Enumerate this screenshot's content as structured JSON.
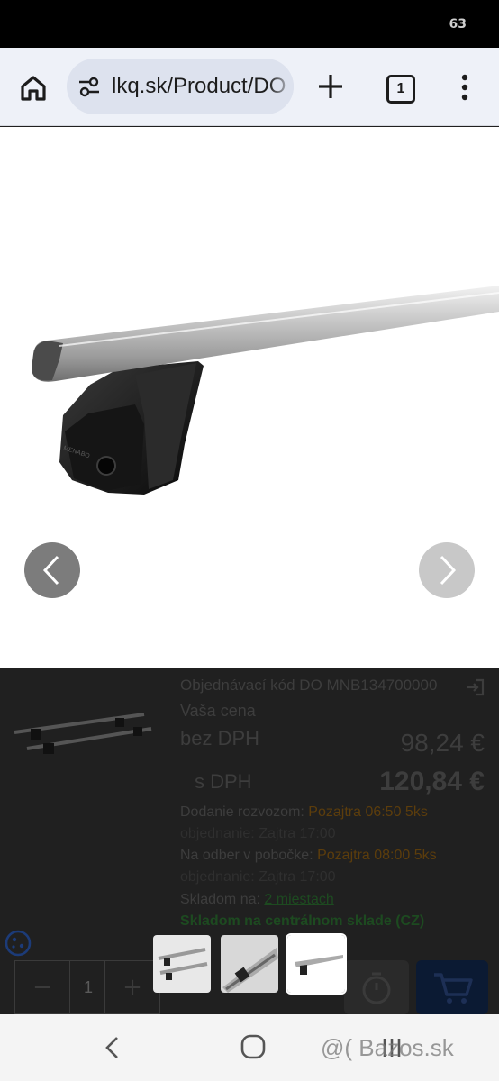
{
  "status_bar": {
    "battery": "63"
  },
  "browser": {
    "url": "lkq.sk/Product/DO",
    "tab_count": "1",
    "icons": [
      "home-icon",
      "site-settings-icon",
      "new-tab-icon",
      "tabs-icon",
      "menu-icon"
    ]
  },
  "viewer": {
    "brand_mark": "MENABO"
  },
  "product": {
    "order_code_label": "Objednávací kód DO MNB134700000",
    "your_price_label": "Vaša cena",
    "price_excl_label": "bez DPH",
    "price_excl_value": "98,24 €",
    "price_incl_label": "s DPH",
    "price_incl_value": "120,84 €",
    "delivery_label": "Dodanie rozvozom:",
    "delivery_value": "Pozajtra 06:50 5ks",
    "order_deadline_1": "objednanie: Zajtra 17:00",
    "pickup_label": "Na odber v pobočke:",
    "pickup_value": "Pozajtra 08:00 5ks",
    "order_deadline_2": "objednanie: Zajtra 17:00",
    "stock_label": "Skladom na:",
    "stock_link": "2 miestach",
    "central_stock": "Skladom na centrálnom sklade (CZ)",
    "quantity": "1",
    "minus_label": "−",
    "plus_label": "+"
  },
  "gallery": {
    "thumbnail_count": 3,
    "active_thumbnail": 3
  },
  "watermark": "@( Bazos.sk",
  "colors": {
    "accent_orange": "#5c3d0c",
    "accent_green": "#1d4a20",
    "cart_blue": "#0b1a33"
  }
}
